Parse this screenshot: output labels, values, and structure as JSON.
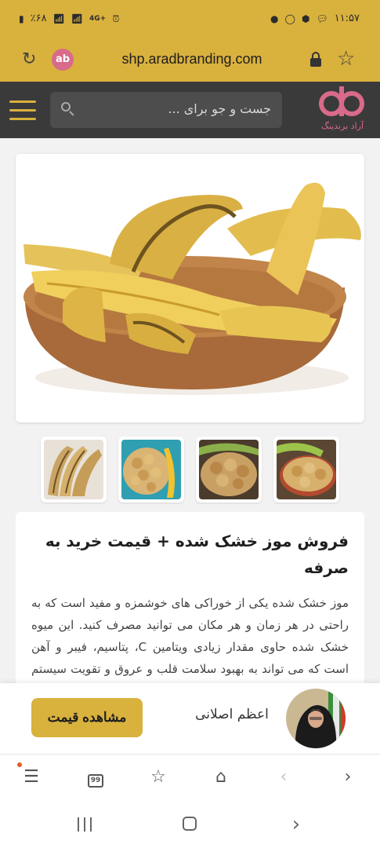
{
  "status_bar": {
    "time": "۱۱:۵۷",
    "battery": "٪۶۸",
    "network": "4G+"
  },
  "browser": {
    "url": "shp.aradbranding.com",
    "site_badge": "ab"
  },
  "site_header": {
    "search_placeholder": "جست و جو برای ...",
    "brand_name": "آراد برندینگ"
  },
  "product": {
    "title": "فروش موز خشک شده + قیمت خرید به صرفه",
    "description": "موز خشک شده یکی از خوراکی های خوشمزه و مفید است که به راحتی در هر زمان و هر مکان می توانید مصرف کنید. این میوه خشک شده حاوی مقدار زیادی ویتامین C، پتاسیم، فیبر و آهن است که می تواند به بهبود سلامت قلب و عروق و تقویت سیستم ایمنی بدن کمک کند."
  },
  "seller": {
    "name": "اعظم اصلانی",
    "price_button": "مشاهده قیمت"
  },
  "bottom_nav": {
    "tabs_count": "99"
  },
  "colors": {
    "accent": "#d9b13d",
    "header_bg": "#3a3a3a",
    "brand_pink": "#d86a8a"
  }
}
